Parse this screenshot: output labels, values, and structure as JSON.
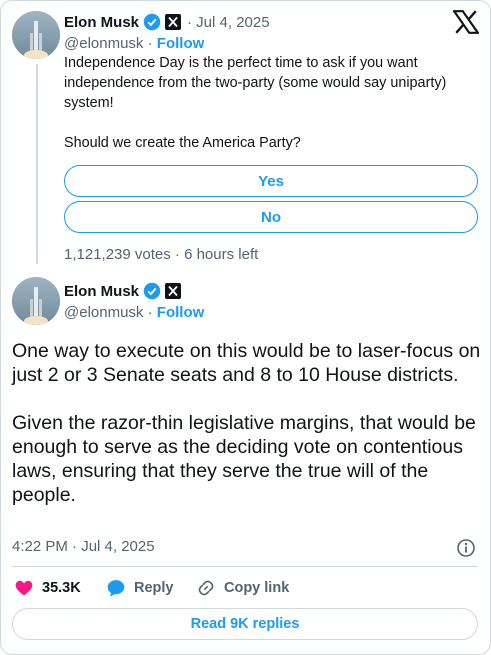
{
  "quoted_tweet": {
    "author_name": "Elon Musk",
    "date": "· Jul 4, 2025",
    "handle": "@elonmusk",
    "follow_label": "Follow",
    "text_line_1": "Independence Day is the perfect time to ask if you want independence from the two-party (some would say uniparty) system!",
    "text_line_2": "Should we create the America Party?",
    "poll": {
      "options": [
        "Yes",
        "No"
      ],
      "meta": "1,121,239 votes · 6 hours left"
    }
  },
  "main_tweet": {
    "author_name": "Elon Musk",
    "handle": "@elonmusk",
    "follow_label": "Follow",
    "paragraph_1": "One way to execute on this would be to laser-focus on just 2 or 3 Senate seats and 8 to 10 House districts.",
    "paragraph_2": "Given the razor-thin legislative margins, that would be enough to serve as the deciding vote on contentious laws, ensuring that they serve the true will of the people.",
    "timestamp": "4:22 PM · Jul 4, 2025"
  },
  "actions": {
    "likes": "35.3K",
    "reply_label": "Reply",
    "copy_link_label": "Copy link"
  },
  "read_replies_label": "Read 9K replies",
  "colors": {
    "accent": "#1d9bf0",
    "like": "#f91880",
    "text_secondary": "#536471",
    "border": "#cfd9de"
  },
  "icons": [
    "verified-badge-icon",
    "x-affiliate-badge-icon",
    "x-logo-icon",
    "info-icon",
    "heart-icon",
    "reply-bubble-icon",
    "link-icon"
  ]
}
